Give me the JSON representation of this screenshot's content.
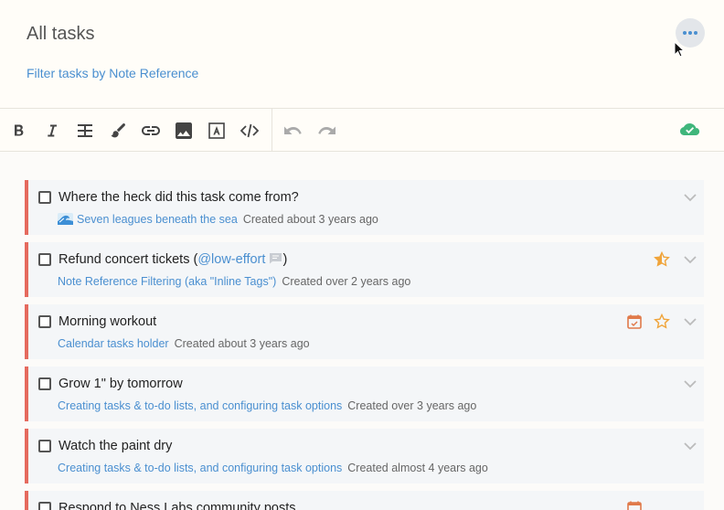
{
  "header": {
    "title": "All tasks",
    "filter_link": "Filter tasks by Note Reference"
  },
  "toolbar": {
    "buttons": [
      "bold-icon",
      "italic-icon",
      "strikethrough-icon",
      "brush-icon",
      "link-icon",
      "image-icon",
      "text-box-icon",
      "code-icon",
      "undo-icon",
      "redo-icon"
    ],
    "sync_icon": "cloud-check-icon",
    "sync_color": "#3fb67b"
  },
  "colors": {
    "accent": "#4a8fd0",
    "task_border": "#e56a5e",
    "star": "#f0a43a",
    "calendar": "#e07a4a"
  },
  "tasks": [
    {
      "title": "Where the heck did this task come from?",
      "note": "Seven leagues beneath the sea",
      "note_icon": "wave-emoji-icon",
      "created": "Created about 3 years ago"
    },
    {
      "title_prefix": "Refund concert tickets (",
      "mention": "@low-effort",
      "title_suffix": ")",
      "note": "Note Reference Filtering (aka \"Inline Tags\")",
      "created": "Created over 2 years ago",
      "icons": [
        "half-star-icon"
      ]
    },
    {
      "title": "Morning workout",
      "note": "Calendar tasks holder",
      "created": "Created about 3 years ago",
      "icons": [
        "calendar-icon",
        "star-icon"
      ]
    },
    {
      "title": "Grow 1\" by tomorrow",
      "note": "Creating tasks & to-do lists, and configuring task options",
      "created": "Created over 3 years ago"
    },
    {
      "title": "Watch the paint dry",
      "note": "Creating tasks & to-do lists, and configuring task options",
      "created": "Created almost 4 years ago"
    },
    {
      "title": "Respond to Ness Labs community posts",
      "icons": [
        "calendar-icon"
      ]
    }
  ]
}
